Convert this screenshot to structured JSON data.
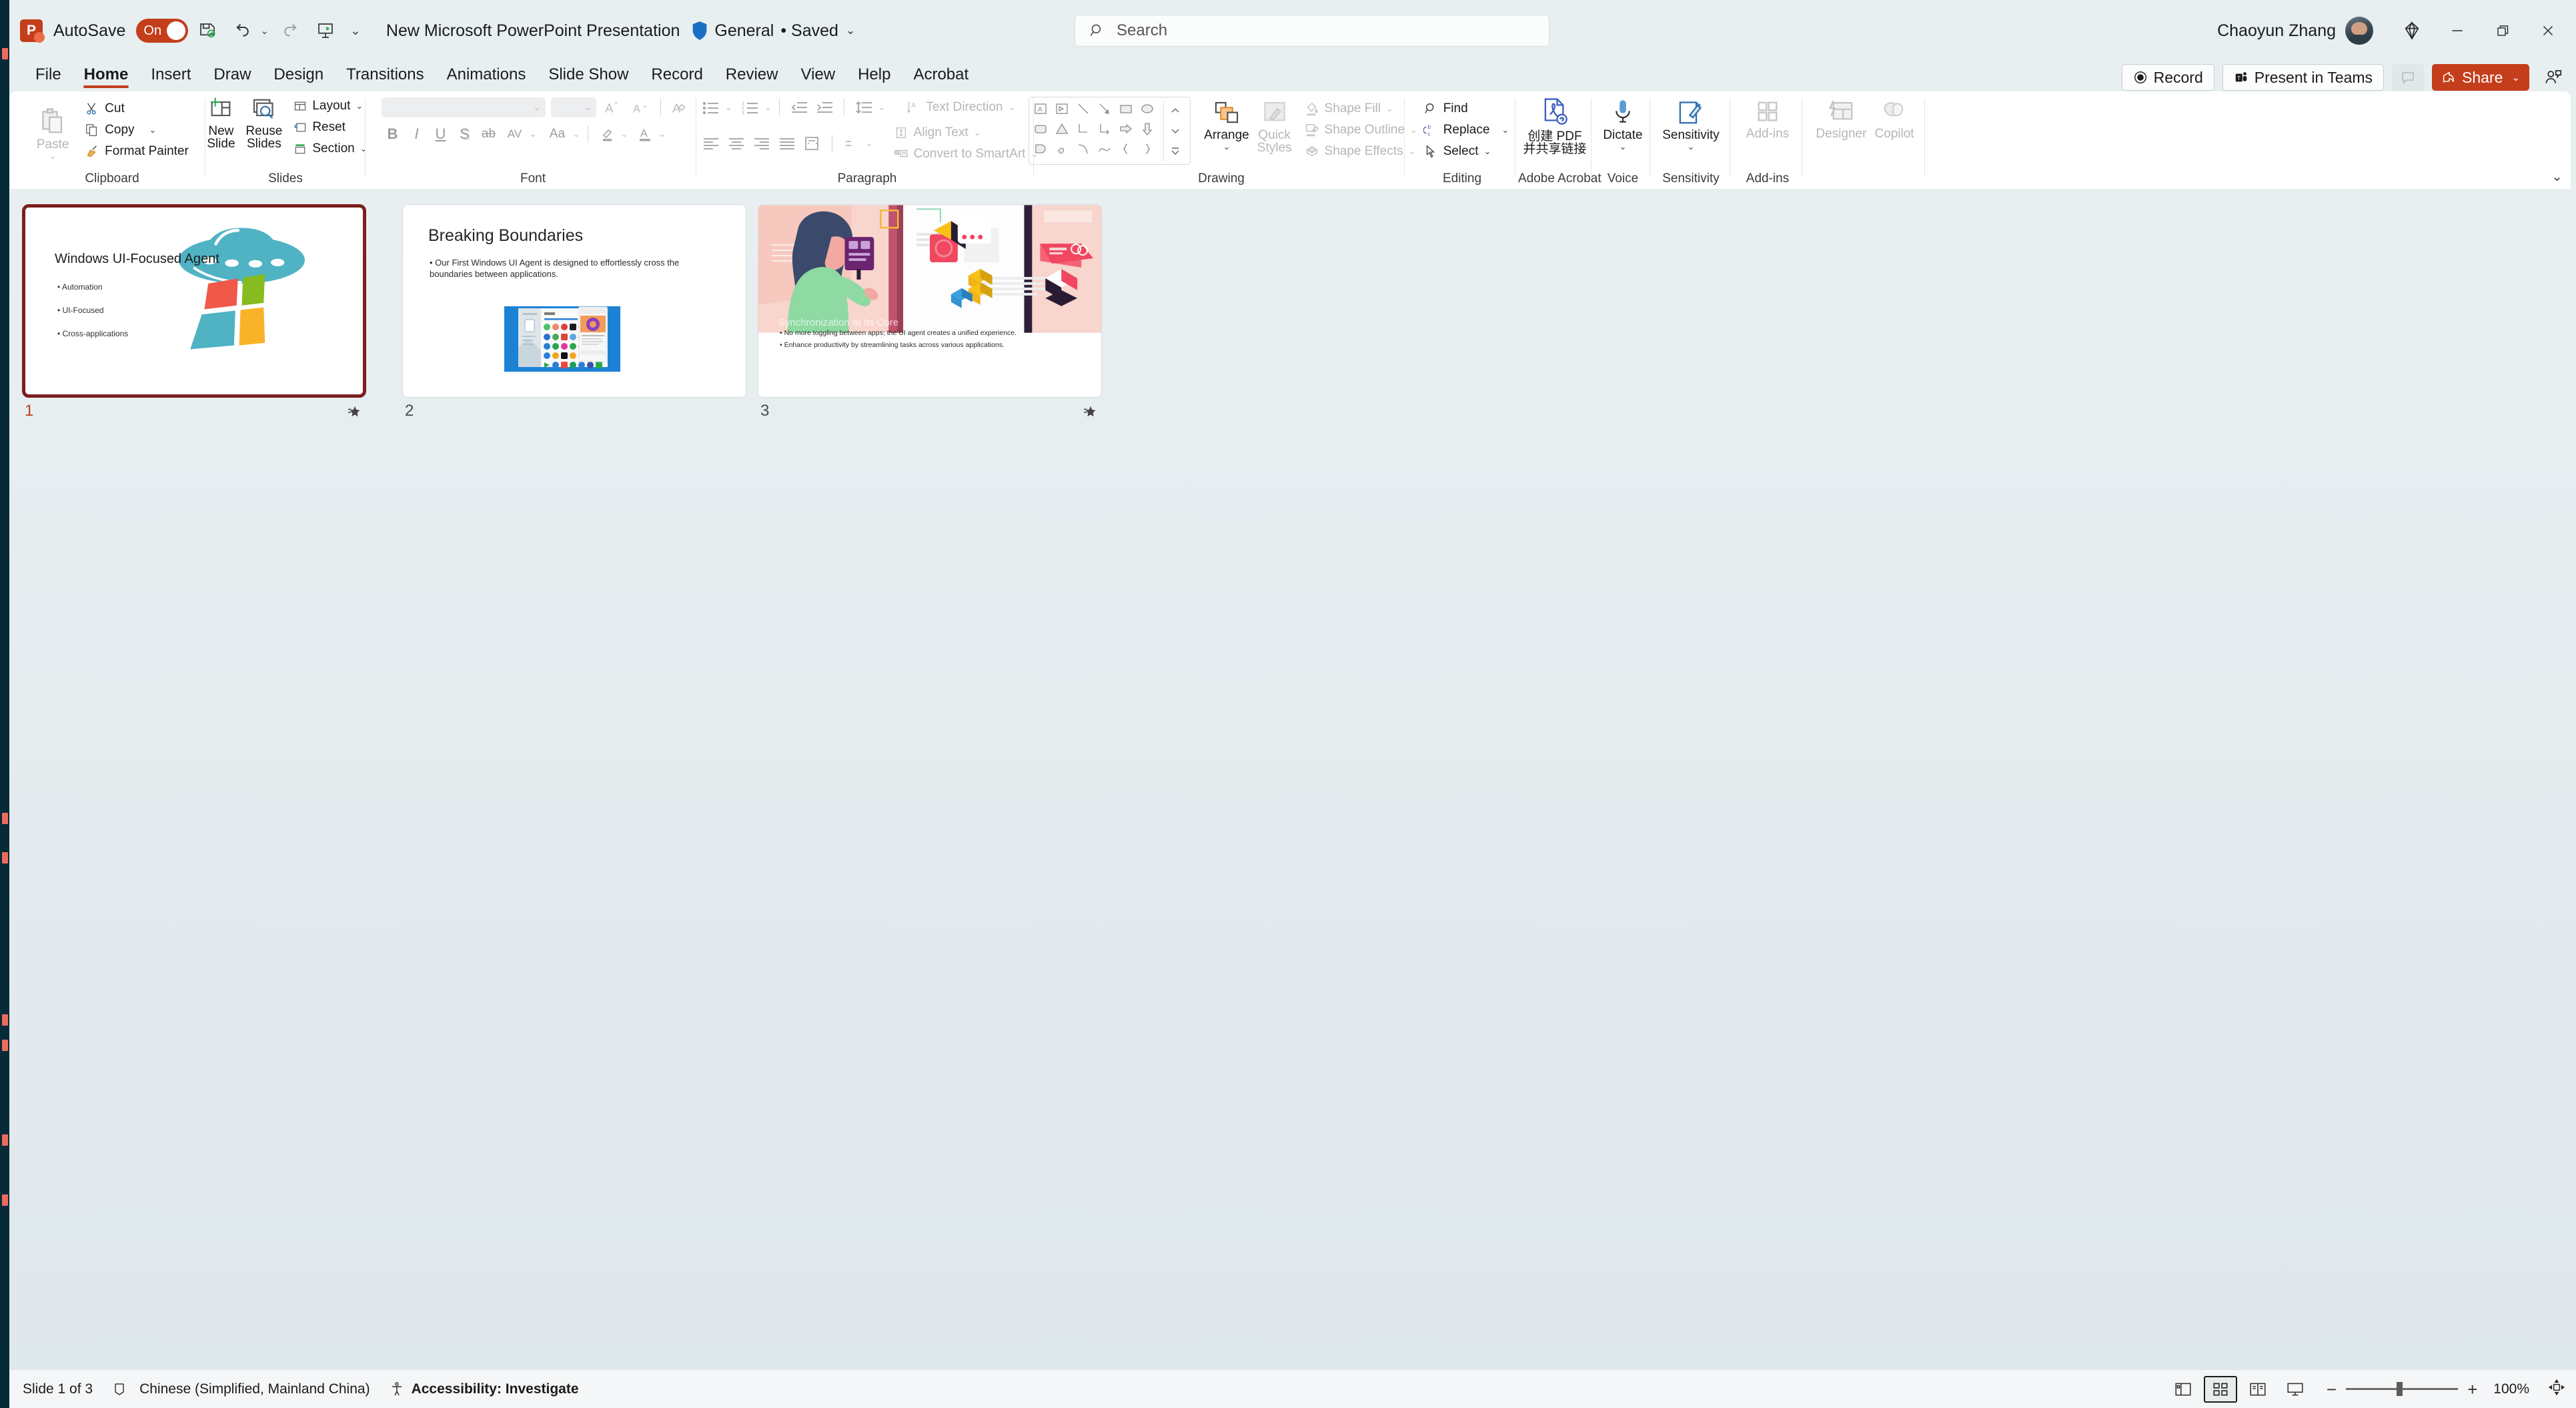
{
  "app": {
    "logo_letter": "P",
    "autosave_label": "AutoSave",
    "autosave_state": "On",
    "document_title": "New Microsoft PowerPoint Presentation",
    "sensitivity_label": "General",
    "saved_label": "• Saved",
    "user_name": "Chaoyun Zhang",
    "accent_color": "#c43e1c"
  },
  "quick_access": [
    {
      "name": "save-icon",
      "tip": "Save"
    },
    {
      "name": "undo-icon",
      "tip": "Undo"
    },
    {
      "name": "redo-icon",
      "tip": "Redo"
    },
    {
      "name": "start-presentation-icon",
      "tip": "Start from Beginning"
    },
    {
      "name": "customize-quick-access-icon",
      "tip": "Customize Quick Access Toolbar"
    }
  ],
  "search": {
    "placeholder": "Search"
  },
  "window_controls": {
    "diamond_label": "diamond-icon",
    "minimize_label": "—",
    "restore_label": "restore",
    "close_label": "✕"
  },
  "tabs": [
    {
      "label": "File",
      "active": false
    },
    {
      "label": "Home",
      "active": true
    },
    {
      "label": "Insert",
      "active": false
    },
    {
      "label": "Draw",
      "active": false
    },
    {
      "label": "Design",
      "active": false
    },
    {
      "label": "Transitions",
      "active": false
    },
    {
      "label": "Animations",
      "active": false
    },
    {
      "label": "Slide Show",
      "active": false
    },
    {
      "label": "Record",
      "active": false
    },
    {
      "label": "Review",
      "active": false
    },
    {
      "label": "View",
      "active": false
    },
    {
      "label": "Help",
      "active": false
    },
    {
      "label": "Acrobat",
      "active": false
    }
  ],
  "tab_actions": {
    "record": "Record",
    "present_in_teams": "Present in Teams",
    "comments": "Comments",
    "share": "Share"
  },
  "ribbon": {
    "clipboard": {
      "label": "Clipboard",
      "paste": "Paste",
      "cut": "Cut",
      "copy": "Copy",
      "format_painter": "Format Painter"
    },
    "slides": {
      "label": "Slides",
      "new_slide_line1": "New",
      "new_slide_line2": "Slide",
      "reuse_line1": "Reuse",
      "reuse_line2": "Slides",
      "layout": "Layout",
      "reset": "Reset",
      "section": "Section"
    },
    "font": {
      "label": "Font",
      "font_name_value": "",
      "font_size_value": "",
      "bold": "B",
      "italic": "I",
      "underline": "U",
      "shadow": "S",
      "strikethrough": "ab",
      "character_spacing": "AV",
      "change_case": "Aa",
      "grow_font": "A",
      "shrink_font": "A",
      "clear_formatting": "A",
      "text_highlight": "text-highlight",
      "font_color": "A"
    },
    "paragraph": {
      "label": "Paragraph",
      "text_direction": "Text Direction",
      "align_text": "Align Text",
      "convert_to_smartart": "Convert to SmartArt"
    },
    "drawing": {
      "label": "Drawing",
      "arrange": "Arrange",
      "quick_styles_line1": "Quick",
      "quick_styles_line2": "Styles",
      "shape_fill": "Shape Fill",
      "shape_outline": "Shape Outline",
      "shape_effects": "Shape Effects"
    },
    "editing": {
      "label": "Editing",
      "find": "Find",
      "replace": "Replace",
      "select": "Select"
    },
    "adobe": {
      "label": "Adobe Acrobat",
      "create_pdf_line1": "创建 PDF",
      "create_pdf_line2": "并共享链接"
    },
    "voice": {
      "label": "Voice",
      "dictate": "Dictate"
    },
    "sensitivity": {
      "label": "Sensitivity",
      "sensitivity": "Sensitivity"
    },
    "addins": {
      "label": "Add-ins",
      "addins": "Add-ins"
    },
    "designer": {
      "designer": "Designer",
      "copilot": "Copilot"
    }
  },
  "slides": [
    {
      "number": "1",
      "selected": true,
      "title": "Windows UI-Focused Agent",
      "bullets": [
        "Automation",
        "UI-Focused",
        "Cross-applications"
      ],
      "has_animation_star": true,
      "art": "ufo-windows-logo"
    },
    {
      "number": "2",
      "selected": false,
      "title": "Breaking Boundaries",
      "bullets": [
        "Our First Windows UI Agent is designed to effortlessly cross the boundaries between applications."
      ],
      "has_animation_star": false,
      "art": "windows-apps-screenshot"
    },
    {
      "number": "3",
      "selected": false,
      "title": "Synchronization at Its Core",
      "bullets": [
        "No more toggling between apps; the UI agent creates a unified experience.",
        "Enhance productivity by streamlining tasks across various applications."
      ],
      "has_animation_star": true,
      "art": "person-with-cubes-illustration"
    }
  ],
  "status_bar": {
    "slide_count": "Slide 1 of 3",
    "language": "Chinese (Simplified, Mainland China)",
    "accessibility": "Accessibility: Investigate",
    "zoom_percent": "100%",
    "views": [
      {
        "name": "normal-view-button",
        "active": false
      },
      {
        "name": "slide-sorter-view-button",
        "active": true
      },
      {
        "name": "reading-view-button",
        "active": false
      },
      {
        "name": "slide-show-button",
        "active": false
      }
    ]
  }
}
